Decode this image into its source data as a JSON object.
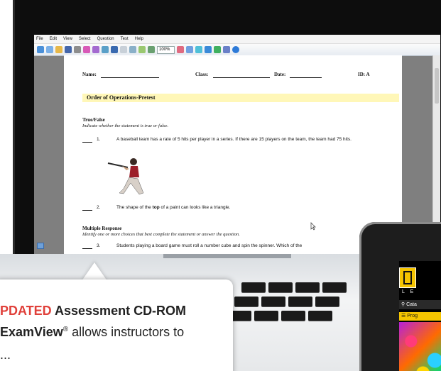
{
  "app": {
    "menu": [
      "File",
      "Edit",
      "View",
      "Select",
      "Question",
      "Test",
      "Help"
    ],
    "zoom": "100%"
  },
  "document": {
    "name_label": "Name:",
    "class_label": "Class:",
    "date_label": "Date:",
    "id_label": "ID: A",
    "title": "Order of Operations-Pretest",
    "section1_title": "True/False",
    "section1_instructions": "Indicate whether the statement is true or false.",
    "q1_num": "1.",
    "q1_text": "A baseball team has a rate of 5 hits per player in a series. If there are 15 players on the team, the team had 75 hits.",
    "q2_num": "2.",
    "q2_pre": "The shape of the ",
    "q2_bold": "top",
    "q2_post": " of a paint can looks like a triangle.",
    "section2_title": "Multiple Response",
    "section2_instructions": "Identify one or more choices that best complete the statement or answer the question.",
    "q3_num": "3.",
    "q3_text": "Students playing a board game must roll a number cube and spin the spinner. Which of the"
  },
  "callout": {
    "line1_red": "PDATED",
    "line1_rest": " Assessment CD-ROM",
    "line2_product": "ExamView",
    "line2_reg": "®",
    "line2_rest": " allows instructors to",
    "line3": "..."
  },
  "phone": {
    "letters": "L  E",
    "search_label": "Cata",
    "button_label": "Prog"
  },
  "colors": {
    "highlight": "#fff7b8",
    "accent_red": "#e0403a",
    "ng_yellow": "#f5c400"
  }
}
